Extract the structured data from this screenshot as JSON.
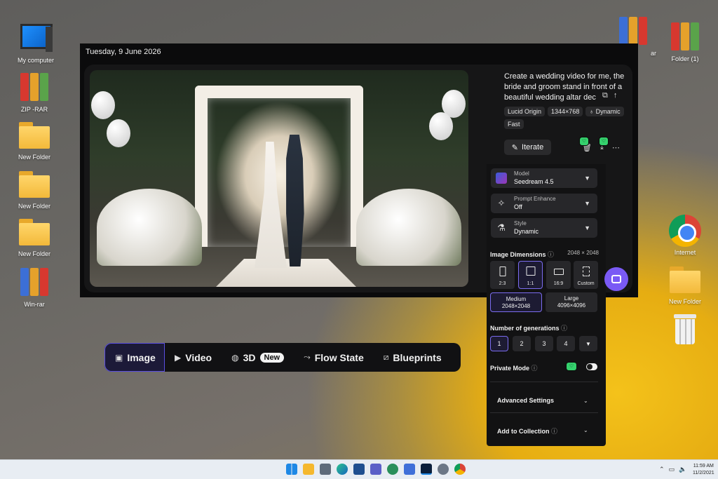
{
  "desktop": {
    "icons_left": [
      {
        "label": "My computer",
        "icon": "computer-icon"
      },
      {
        "label": "ZIP -RAR",
        "icon": "winrar-icon"
      },
      {
        "label": "New Folder",
        "icon": "folder-icon"
      },
      {
        "label": "New Folder",
        "icon": "folder-icon"
      },
      {
        "label": "New Folder",
        "icon": "folder-icon"
      },
      {
        "label": "Win-rar",
        "icon": "winrar-icon"
      }
    ],
    "icons_right": [
      {
        "label": "ar",
        "icon": "winrar-icon"
      },
      {
        "label": "Folder (1)",
        "icon": "winrar-icon"
      },
      {
        "label": "Internet",
        "icon": "chrome-icon"
      },
      {
        "label": "New Folder",
        "icon": "folder-icon"
      },
      {
        "label": "",
        "icon": "trash-icon"
      }
    ]
  },
  "app": {
    "date": "Tuesday, 9 June 2026",
    "prompt": "Create a wedding video for me, the bride and groom stand in front of a beautiful wedding altar dec",
    "tags": [
      "Lucid Origin",
      "1344×768",
      "Dynamic",
      "Fast"
    ],
    "iterate_label": "Iterate",
    "settings": {
      "model": {
        "label": "Model",
        "value": "Seedream 4.5"
      },
      "prompt_enhance": {
        "label": "Prompt Enhance",
        "value": "Off"
      },
      "style": {
        "label": "Style",
        "value": "Dynamic"
      },
      "image_dimensions": {
        "label": "Image Dimensions",
        "value": "2048 × 2048",
        "ratios": [
          "2:3",
          "1:1",
          "16:9",
          "Custom"
        ],
        "selected_ratio": "1:1",
        "sizes": [
          {
            "name": "Medium",
            "dims": "2048×2048",
            "selected": true
          },
          {
            "name": "Large",
            "dims": "4096×4096",
            "selected": false
          }
        ]
      },
      "generations": {
        "label": "Number of generations",
        "options": [
          "1",
          "2",
          "3",
          "4"
        ],
        "selected": "1"
      },
      "private_mode": {
        "label": "Private Mode",
        "on": false
      },
      "advanced_settings": "Advanced Settings",
      "add_to_collection": "Add to Collection"
    }
  },
  "modebar": {
    "items": [
      {
        "label": "Image",
        "active": true,
        "icon": "image-icon"
      },
      {
        "label": "Video",
        "active": false,
        "icon": "video-icon"
      },
      {
        "label": "3D",
        "active": false,
        "icon": "cube-icon",
        "badge": "New"
      },
      {
        "label": "Flow State",
        "active": false,
        "icon": "flow-icon"
      },
      {
        "label": "Blueprints",
        "active": false,
        "icon": "blueprint-icon"
      }
    ]
  },
  "taskbar": {
    "time": "11:59 AM",
    "date": "11/2/2021"
  },
  "colors": {
    "accent": "#7b6cf0",
    "green_badge": "#35d16d",
    "panel_bg": "#121213"
  }
}
